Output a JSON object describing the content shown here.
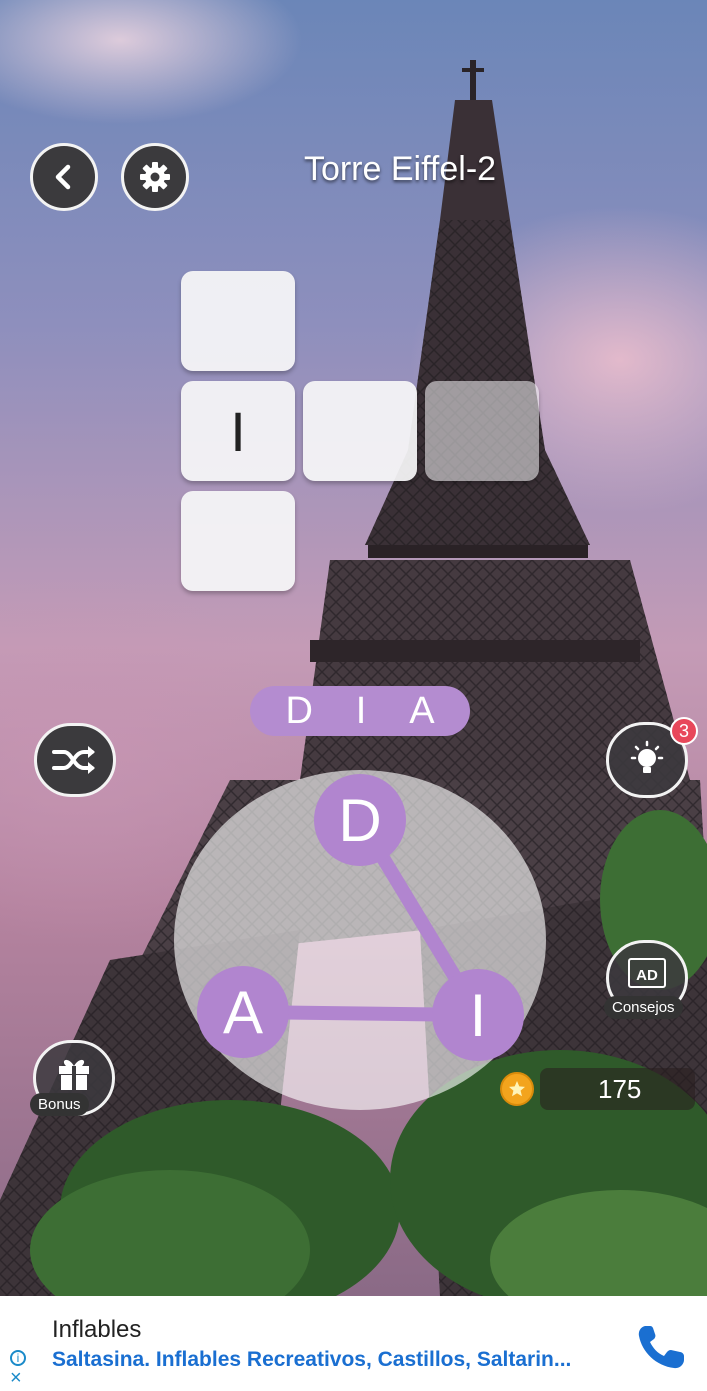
{
  "header": {
    "back_icon": "chevron-left-icon",
    "settings_icon": "gear-icon",
    "level_title": "Torre Eiffel-2"
  },
  "grid": {
    "tiles": [
      {
        "letter": ""
      },
      {
        "letter": "I"
      },
      {
        "letter": ""
      },
      {
        "letter": ""
      },
      {
        "letter": ""
      }
    ]
  },
  "preview": {
    "letters": [
      "D",
      "I",
      "A"
    ]
  },
  "wheel": {
    "letters": [
      "D",
      "I",
      "A"
    ]
  },
  "controls": {
    "shuffle_icon": "shuffle-icon",
    "hint_icon": "lightbulb-icon",
    "hint_count": "3",
    "ad_icon_text": "AD",
    "ad_label": "Consejos",
    "bonus_icon": "gift-icon",
    "bonus_label": "Bonus"
  },
  "coins": {
    "value": "175"
  },
  "ad_banner": {
    "title": "Inflables",
    "description": "Saltasina. Inflables Recreativos, Castillos, Saltarin...",
    "info_icon": "i",
    "close_icon": "×"
  },
  "colors": {
    "accent_purple": "#b185cf",
    "badge_red": "#e8475a",
    "coin_orange": "#f3a41d",
    "ad_link_blue": "#1a6fd1"
  }
}
